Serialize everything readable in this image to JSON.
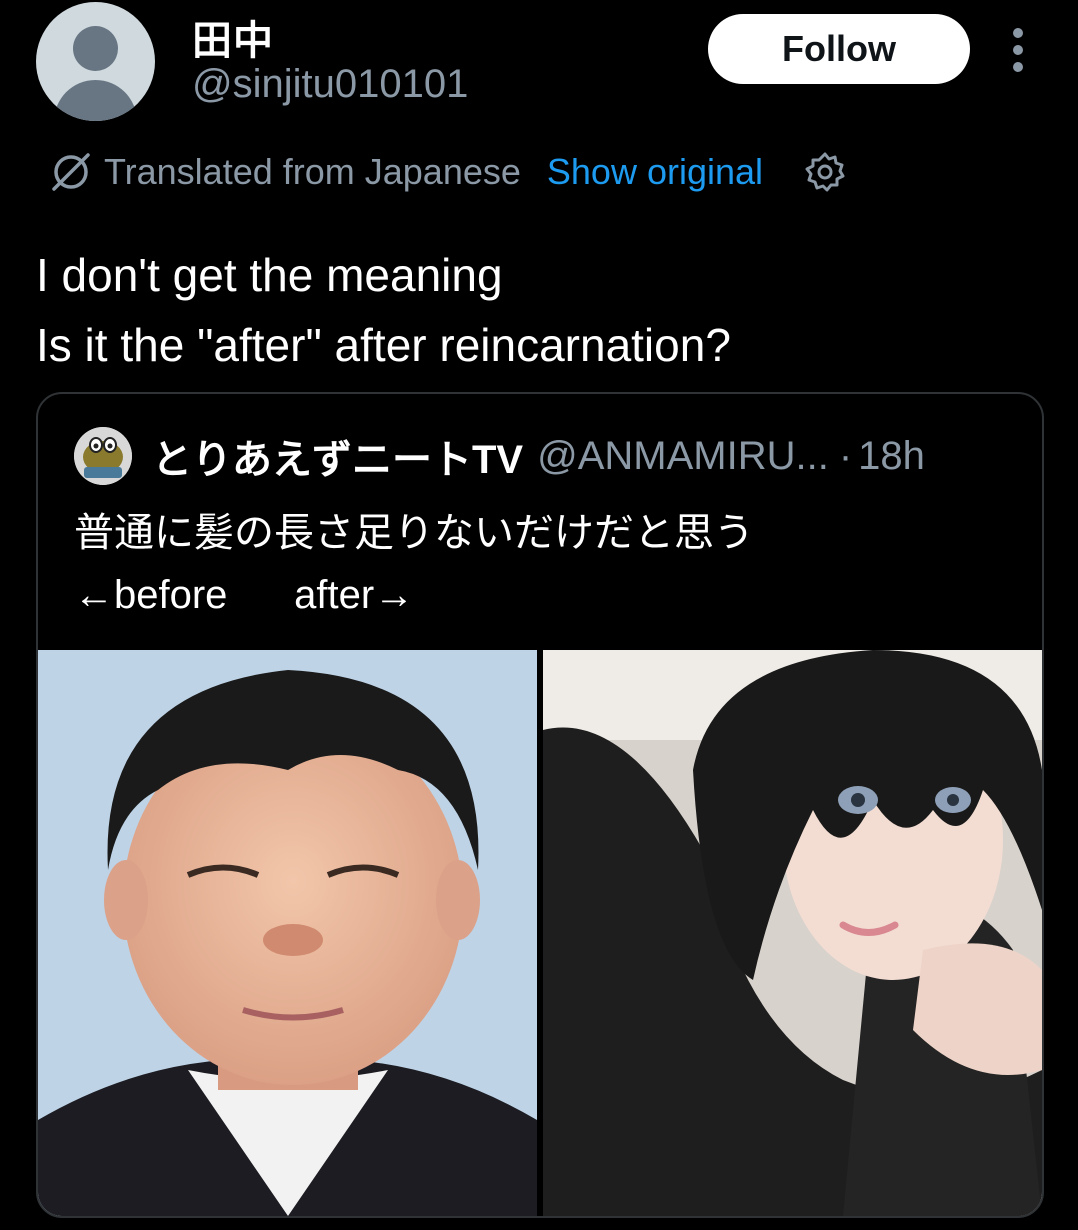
{
  "author": {
    "display_name": "田中",
    "handle": "@sinjitu010101",
    "avatar_icon": "default-profile-icon"
  },
  "actions": {
    "follow_label": "Follow",
    "more_icon": "more-vertical-icon"
  },
  "translation": {
    "icon": "globe-slash-icon",
    "label": "Translated from Japanese",
    "show_original_label": "Show original",
    "settings_icon": "gear-icon"
  },
  "post": {
    "lines": [
      "I don't get the meaning",
      "Is it the \"after\" after reincarnation?"
    ]
  },
  "quote": {
    "display_name": "とりあえずニートTV",
    "handle": "@ANMAMIRU...",
    "separator": "·",
    "time": "18h",
    "lines": [
      "普通に髪の長さ足りないだけだと思う",
      "←before      after→"
    ],
    "media": [
      {
        "name": "before-photo",
        "kind": "image"
      },
      {
        "name": "after-photo",
        "kind": "image"
      }
    ]
  },
  "colors": {
    "background": "#000000",
    "primary_text": "#ffffff",
    "secondary_text": "#8b98a5",
    "link": "#1d9bf0",
    "border": "#2f3336",
    "follow_bg": "#ffffff"
  }
}
